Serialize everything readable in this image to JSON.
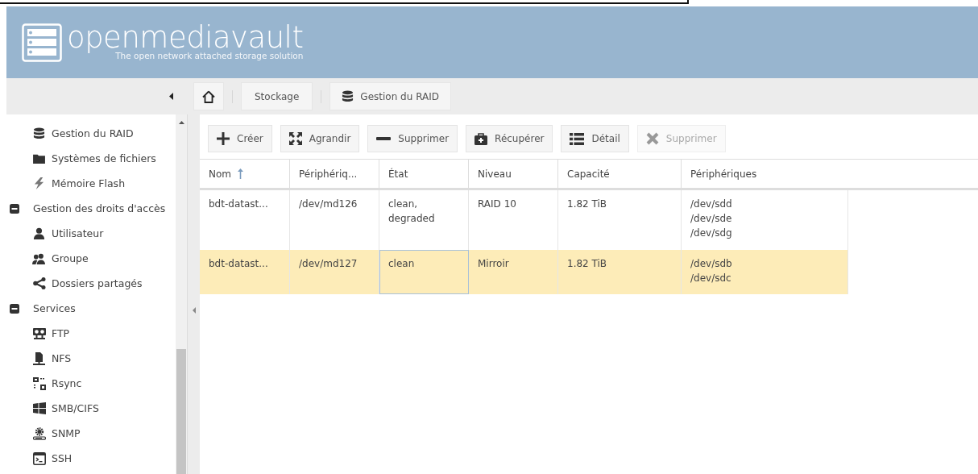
{
  "header": {
    "logo_text": "openmediavault",
    "tagline": "The open network attached storage solution"
  },
  "breadcrumb": [
    {
      "label": "Stockage"
    },
    {
      "label": "Gestion du RAID"
    }
  ],
  "sidebar": {
    "tree": [
      {
        "children": [
          {
            "label": "Gestion du RAID"
          },
          {
            "label": "Systèmes de fichiers"
          },
          {
            "label": "Mémoire Flash"
          }
        ]
      },
      {
        "label": "Gestion des droits d'accès",
        "expanded": true,
        "children": [
          {
            "label": "Utilisateur"
          },
          {
            "label": "Groupe"
          },
          {
            "label": "Dossiers partagés"
          }
        ]
      },
      {
        "label": "Services",
        "expanded": true,
        "children": [
          {
            "label": "FTP"
          },
          {
            "label": "NFS"
          },
          {
            "label": "Rsync"
          },
          {
            "label": "SMB/CIFS"
          },
          {
            "label": "SNMP"
          },
          {
            "label": "SSH"
          }
        ]
      }
    ]
  },
  "toolbar": [
    {
      "label": "Créer",
      "disabled": false
    },
    {
      "label": "Agrandir",
      "disabled": false
    },
    {
      "label": "Supprimer",
      "disabled": false
    },
    {
      "label": "Récupérer",
      "disabled": false
    },
    {
      "label": "Détail",
      "disabled": false
    },
    {
      "label": "Supprimer",
      "disabled": true
    }
  ],
  "table": {
    "columns": [
      {
        "label": "Nom",
        "sorted": true
      },
      {
        "label": "Périphériq...",
        "sorted": false
      },
      {
        "label": "État",
        "sorted": false
      },
      {
        "label": "Niveau",
        "sorted": false
      },
      {
        "label": "Capacité",
        "sorted": false
      },
      {
        "label": "Périphériques",
        "sorted": false
      }
    ],
    "rows": [
      {
        "selected": false,
        "cells": [
          {
            "text": "bdt-datast...",
            "focused": false
          },
          {
            "text": "/dev/md126",
            "focused": false
          },
          {
            "text": "clean,\ndegraded",
            "focused": false
          },
          {
            "text": "RAID 10",
            "focused": false
          },
          {
            "text": "1.82 TiB",
            "focused": false
          },
          {
            "text": "/dev/sdd\n/dev/sde\n/dev/sdg",
            "focused": false
          }
        ]
      },
      {
        "selected": true,
        "cells": [
          {
            "text": "bdt-datast...",
            "focused": false
          },
          {
            "text": "/dev/md127",
            "focused": false
          },
          {
            "text": "clean",
            "focused": true
          },
          {
            "text": "Mirroir",
            "focused": false
          },
          {
            "text": "1.82 TiB",
            "focused": false
          },
          {
            "text": "/dev/sdb\n/dev/sdc",
            "focused": false
          }
        ]
      }
    ]
  }
}
